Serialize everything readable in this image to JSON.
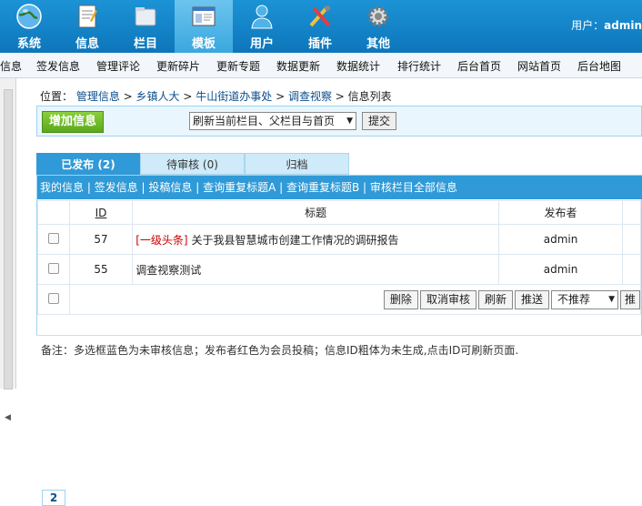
{
  "topnav": {
    "items": [
      {
        "label": "系统",
        "icon": "globe-icon"
      },
      {
        "label": "信息",
        "icon": "document-icon"
      },
      {
        "label": "栏目",
        "icon": "folder-icon"
      },
      {
        "label": "模板",
        "icon": "template-icon"
      },
      {
        "label": "用户",
        "icon": "user-icon"
      },
      {
        "label": "插件",
        "icon": "tools-icon"
      },
      {
        "label": "其他",
        "icon": "gear-icon"
      }
    ],
    "active": "模板",
    "user_prefix": "用户：",
    "user_name": "admin"
  },
  "menu": {
    "items": [
      "信息",
      "签发信息",
      "管理评论",
      "更新碎片",
      "更新专题",
      "数据更新",
      "数据统计",
      "排行统计",
      "后台首页",
      "网站首页",
      "后台地图"
    ]
  },
  "breadcrumb": {
    "prefix": "位置：",
    "items": [
      "管理信息",
      "乡镇人大",
      "牛山街道办事处",
      "调查视察",
      "信息列表"
    ],
    "sep": " > "
  },
  "actions": {
    "add_label": "增加信息",
    "refresh_selected": "刷新当前栏目、父栏目与首页",
    "submit_label": "提交"
  },
  "tabs": [
    {
      "label": "已发布 (2)",
      "active": true
    },
    {
      "label": "待审核 (0)",
      "active": false
    },
    {
      "label": "归档",
      "active": false
    }
  ],
  "links": [
    "我的信息",
    "签发信息",
    "投稿信息",
    "查询重复标题A",
    "查询重复标题B",
    "审核栏目全部信息"
  ],
  "table": {
    "headers": {
      "id": "ID",
      "title": "标题",
      "publisher": "发布者"
    },
    "rows": [
      {
        "id": "57",
        "tag": "[一级头条]",
        "title": "关于我县智慧城市创建工作情况的调研报告",
        "publisher": "admin"
      },
      {
        "id": "55",
        "tag": "",
        "title": "调查视察测试",
        "publisher": "admin"
      }
    ],
    "buttons": [
      "删除",
      "取消审核",
      "刷新",
      "推送"
    ],
    "recommend_selected": "不推荐",
    "extra_button_partial": "推"
  },
  "pager": {
    "page": "2"
  },
  "note": "备注：多选框蓝色为未审核信息；发布者红色为会员投稿；信息ID粗体为未生成,点击ID可刷新页面.",
  "colors": {
    "nav_bg": "#1b93d6",
    "tab_active": "#2f9ad7",
    "add_button": "#5aa91b",
    "tag_red": "#cc0000"
  }
}
